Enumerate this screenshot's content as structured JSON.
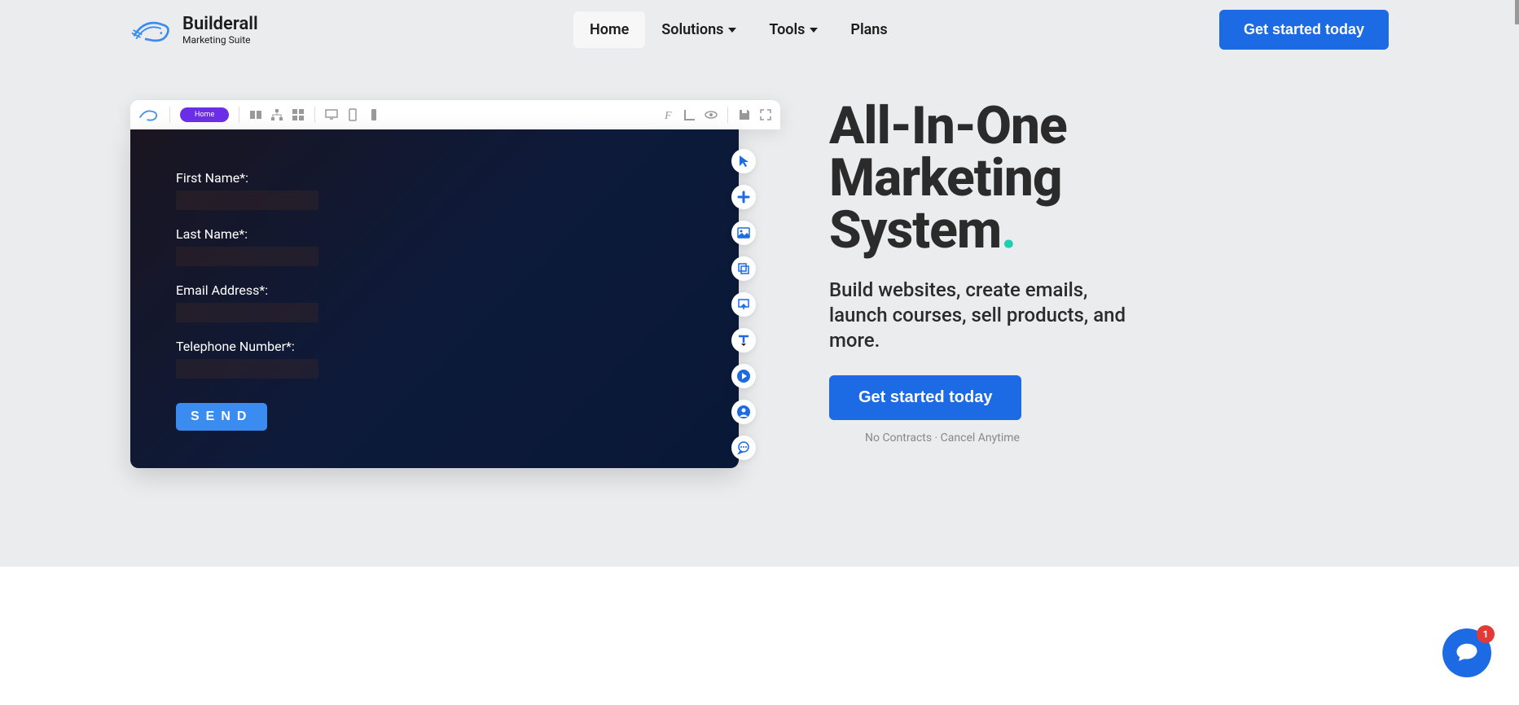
{
  "brand": {
    "name": "Builderall",
    "tagline": "Marketing Suite"
  },
  "nav": {
    "home": "Home",
    "solutions": "Solutions",
    "tools": "Tools",
    "plans": "Plans"
  },
  "cta_header": "Get started today",
  "editor": {
    "pill": "Home",
    "form": {
      "first_name": "First Name*:",
      "last_name": "Last Name*:",
      "email": "Email Address*:",
      "phone": "Telephone Number*:",
      "send": "SEND"
    }
  },
  "hero": {
    "title_l1": "All-In-One",
    "title_l2": "Marketing",
    "title_l3": "System",
    "title_dot": ".",
    "subtitle": "Build websites, create emails, launch courses, sell products, and more.",
    "cta": "Get started today",
    "note": "No Contracts · Cancel Anytime"
  },
  "chat": {
    "badge": "1"
  }
}
